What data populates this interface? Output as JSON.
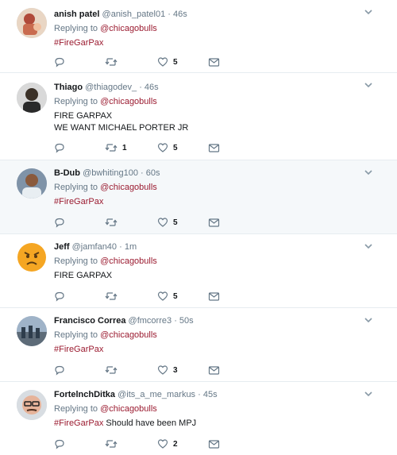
{
  "tweets": [
    {
      "name": "anish patel",
      "handle": "@anish_patel01",
      "time": "46s",
      "replying_prefix": "Replying to ",
      "replying_to": "@chicagobulls",
      "lines": [
        [
          {
            "t": "#FireGarPax",
            "hashtag": true
          }
        ]
      ],
      "retweets": "",
      "likes": "5"
    },
    {
      "name": "Thiago",
      "handle": "@thiagodev_",
      "time": "46s",
      "replying_prefix": "Replying to ",
      "replying_to": "@chicagobulls",
      "lines": [
        [
          {
            "t": "FIRE GARPAX",
            "hashtag": false
          }
        ],
        [
          {
            "t": "WE WANT MICHAEL PORTER JR",
            "hashtag": false
          }
        ]
      ],
      "retweets": "1",
      "likes": "5"
    },
    {
      "name": "B-Dub",
      "handle": "@bwhiting100",
      "time": "60s",
      "replying_prefix": "Replying to ",
      "replying_to": "@chicagobulls",
      "lines": [
        [
          {
            "t": "#FireGarPax",
            "hashtag": true
          }
        ]
      ],
      "retweets": "",
      "likes": "5"
    },
    {
      "name": "Jeff",
      "handle": "@jamfan40",
      "time": "1m",
      "replying_prefix": "Replying to ",
      "replying_to": "@chicagobulls",
      "lines": [
        [
          {
            "t": "FIRE GARPAX",
            "hashtag": false
          }
        ]
      ],
      "retweets": "",
      "likes": "5"
    },
    {
      "name": "Francisco Correa",
      "handle": "@fmcorre3",
      "time": "50s",
      "replying_prefix": "Replying to ",
      "replying_to": "@chicagobulls",
      "lines": [
        [
          {
            "t": "#FireGarPax",
            "hashtag": true
          }
        ]
      ],
      "retweets": "",
      "likes": "3"
    },
    {
      "name": "FortelnchDitka",
      "handle": "@its_a_me_markus",
      "time": "45s",
      "replying_prefix": "Replying to ",
      "replying_to": "@chicagobulls",
      "lines": [
        [
          {
            "t": "#FireGarPax",
            "hashtag": true
          },
          {
            "t": " Should have been MPJ",
            "hashtag": false
          }
        ]
      ],
      "retweets": "",
      "likes": "2"
    }
  ],
  "icons": {
    "reply": "reply-icon",
    "retweet": "retweet-icon",
    "like": "heart-icon",
    "message": "envelope-icon",
    "menu": "chevron-down-icon"
  },
  "colors": {
    "hashtag": "#9b1b30",
    "mention": "#9b1b30",
    "muted": "#657786",
    "highlight_bg": "#f5f8fa",
    "divider": "#e6ecf0"
  }
}
